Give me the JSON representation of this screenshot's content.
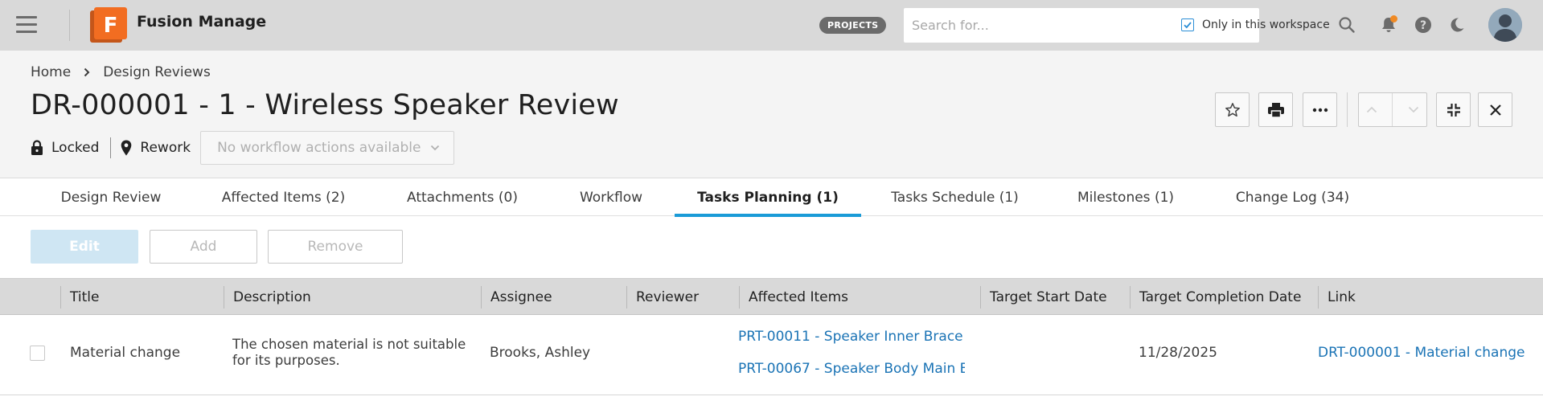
{
  "app": {
    "name": "Fusion Manage",
    "logo_letter": "F",
    "brand_color": "#f26d21"
  },
  "topbar": {
    "projects_label": "PROJECTS",
    "search": {
      "placeholder": "Search for...",
      "value": "",
      "only_in_workspace_label": "Only in this workspace",
      "only_in_workspace_checked": true
    },
    "icons": [
      "menu-icon",
      "search-icon",
      "bell-icon",
      "help-icon",
      "moon-icon",
      "avatar"
    ]
  },
  "breadcrumb": {
    "items": [
      "Home",
      "Design Reviews"
    ]
  },
  "record": {
    "title": "DR-000001 - 1 - Wireless Speaker Review",
    "lock_label": "Locked",
    "state_label": "Rework",
    "workflow_actions": "No workflow actions available"
  },
  "tabs": [
    {
      "label": "Design Review",
      "active": false
    },
    {
      "label": "Affected Items (2)",
      "active": false
    },
    {
      "label": "Attachments (0)",
      "active": false
    },
    {
      "label": "Workflow",
      "active": false
    },
    {
      "label": "Tasks Planning (1)",
      "active": true
    },
    {
      "label": "Tasks Schedule (1)",
      "active": false
    },
    {
      "label": "Milestones (1)",
      "active": false
    },
    {
      "label": "Change Log (34)",
      "active": false
    }
  ],
  "toolbar": {
    "edit_label": "Edit",
    "add_label": "Add",
    "remove_label": "Remove"
  },
  "table": {
    "columns": [
      "Title",
      "Description",
      "Assignee",
      "Reviewer",
      "Affected Items",
      "Target Start Date",
      "Target Completion Date",
      "Link"
    ],
    "rows": [
      {
        "title": "Material change",
        "description_line1": "The chosen material is not suitable",
        "description_line2": "for its purposes.",
        "assignee": "Brooks, Ashley",
        "reviewer": "",
        "affected_item_1": "PRT-00011 - Speaker Inner Brace [",
        "affected_item_2": "PRT-00067 - Speaker Body Main B",
        "target_start_date": "",
        "target_completion_date": "11/28/2025",
        "link": "DRT-000001 - Material change"
      }
    ]
  },
  "colors": {
    "accent": "#1a9bd7",
    "link": "#1a73b5",
    "topbar_bg": "#d9d9d9",
    "header_bg": "#f4f4f4"
  }
}
